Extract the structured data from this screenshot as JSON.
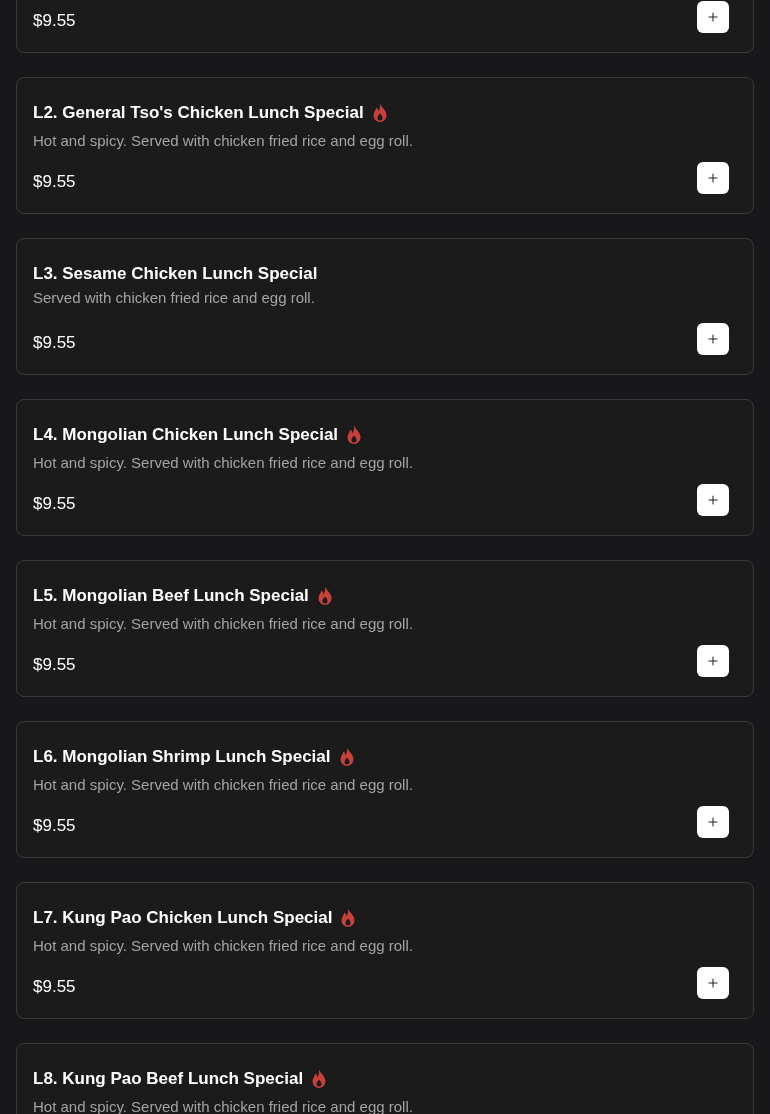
{
  "items": [
    {
      "price": "$9.55"
    },
    {
      "name": "L2. General Tso's Chicken Lunch Special",
      "spicy": true,
      "description": "Hot and spicy. Served with chicken fried rice and egg roll.",
      "price": "$9.55"
    },
    {
      "name": "L3. Sesame Chicken Lunch Special",
      "spicy": false,
      "description": "Served with chicken fried rice and egg roll.",
      "price": "$9.55"
    },
    {
      "name": "L4. Mongolian Chicken Lunch Special",
      "spicy": true,
      "description": "Hot and spicy. Served with chicken fried rice and egg roll.",
      "price": "$9.55"
    },
    {
      "name": "L5. Mongolian Beef Lunch Special",
      "spicy": true,
      "description": "Hot and spicy. Served with chicken fried rice and egg roll.",
      "price": "$9.55"
    },
    {
      "name": "L6. Mongolian Shrimp Lunch Special",
      "spicy": true,
      "description": "Hot and spicy. Served with chicken fried rice and egg roll.",
      "price": "$9.55"
    },
    {
      "name": "L7. Kung Pao Chicken Lunch Special",
      "spicy": true,
      "description": "Hot and spicy. Served with chicken fried rice and egg roll.",
      "price": "$9.55"
    },
    {
      "name": "L8. Kung Pao Beef Lunch Special",
      "spicy": true,
      "description": "Hot and spicy. Served with chicken fried rice and egg roll."
    }
  ]
}
